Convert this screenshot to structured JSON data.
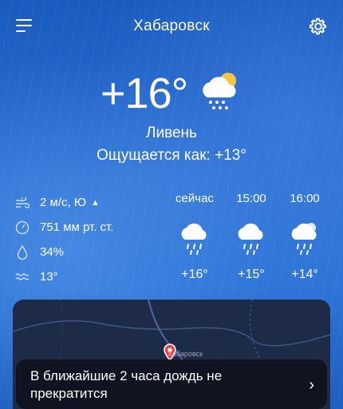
{
  "header": {
    "city": "Хабаровск"
  },
  "current": {
    "temperature": "+16°",
    "condition": "Ливень",
    "feels_like": "Ощущается как: +13°",
    "icon": "partly-cloudy-rain-icon"
  },
  "stats": [
    {
      "icon": "wind-icon",
      "value": "2 м/с, Ю"
    },
    {
      "icon": "pressure-icon",
      "value": "751 мм рт. ст."
    },
    {
      "icon": "humidity-icon",
      "value": "34%"
    },
    {
      "icon": "water-temp-icon",
      "value": "13°"
    }
  ],
  "forecast": [
    {
      "time": "сейчас",
      "temp": "+16°",
      "icon": "rain-cloud-icon"
    },
    {
      "time": "15:00",
      "temp": "+15°",
      "icon": "rain-cloud-icon"
    },
    {
      "time": "16:00",
      "temp": "+14°",
      "icon": "partly-cloudy-rain-icon"
    }
  ],
  "map": {
    "city_label": "Хабаровск"
  },
  "banner": {
    "text": "В ближайшие 2 часа дождь не прекратится"
  },
  "colors": {
    "background": "#1b5fc4",
    "banner": "#0f1420",
    "map": "#1c2a44",
    "pin": "#e24a4a"
  }
}
